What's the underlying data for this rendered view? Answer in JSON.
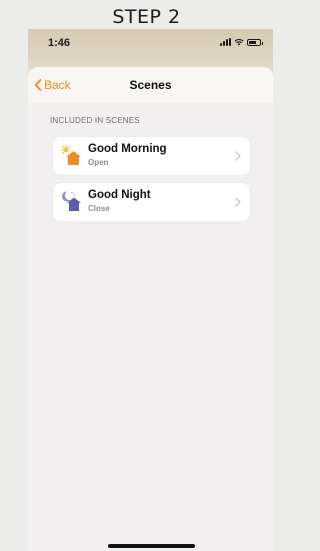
{
  "page": {
    "step_title": "STEP 2"
  },
  "status_bar": {
    "time": "1:46",
    "icons": [
      "cellular-signal-icon",
      "wifi-icon",
      "battery-icon"
    ],
    "battery_level": 0.65
  },
  "nav": {
    "back_label": "Back",
    "title": "Scenes"
  },
  "section": {
    "header": "INCLUDED IN SCENES"
  },
  "scenes": [
    {
      "name": "Good Morning",
      "status": "Open",
      "icon": "sunrise-home-icon"
    },
    {
      "name": "Good Night",
      "status": "Close",
      "icon": "moon-home-icon"
    }
  ],
  "colors": {
    "accent": "#f08a24",
    "morning_home": "#f08a24",
    "morning_sun": "#f5c542",
    "night_home": "#5b5fa8",
    "night_moon": "#8a8fd0"
  }
}
